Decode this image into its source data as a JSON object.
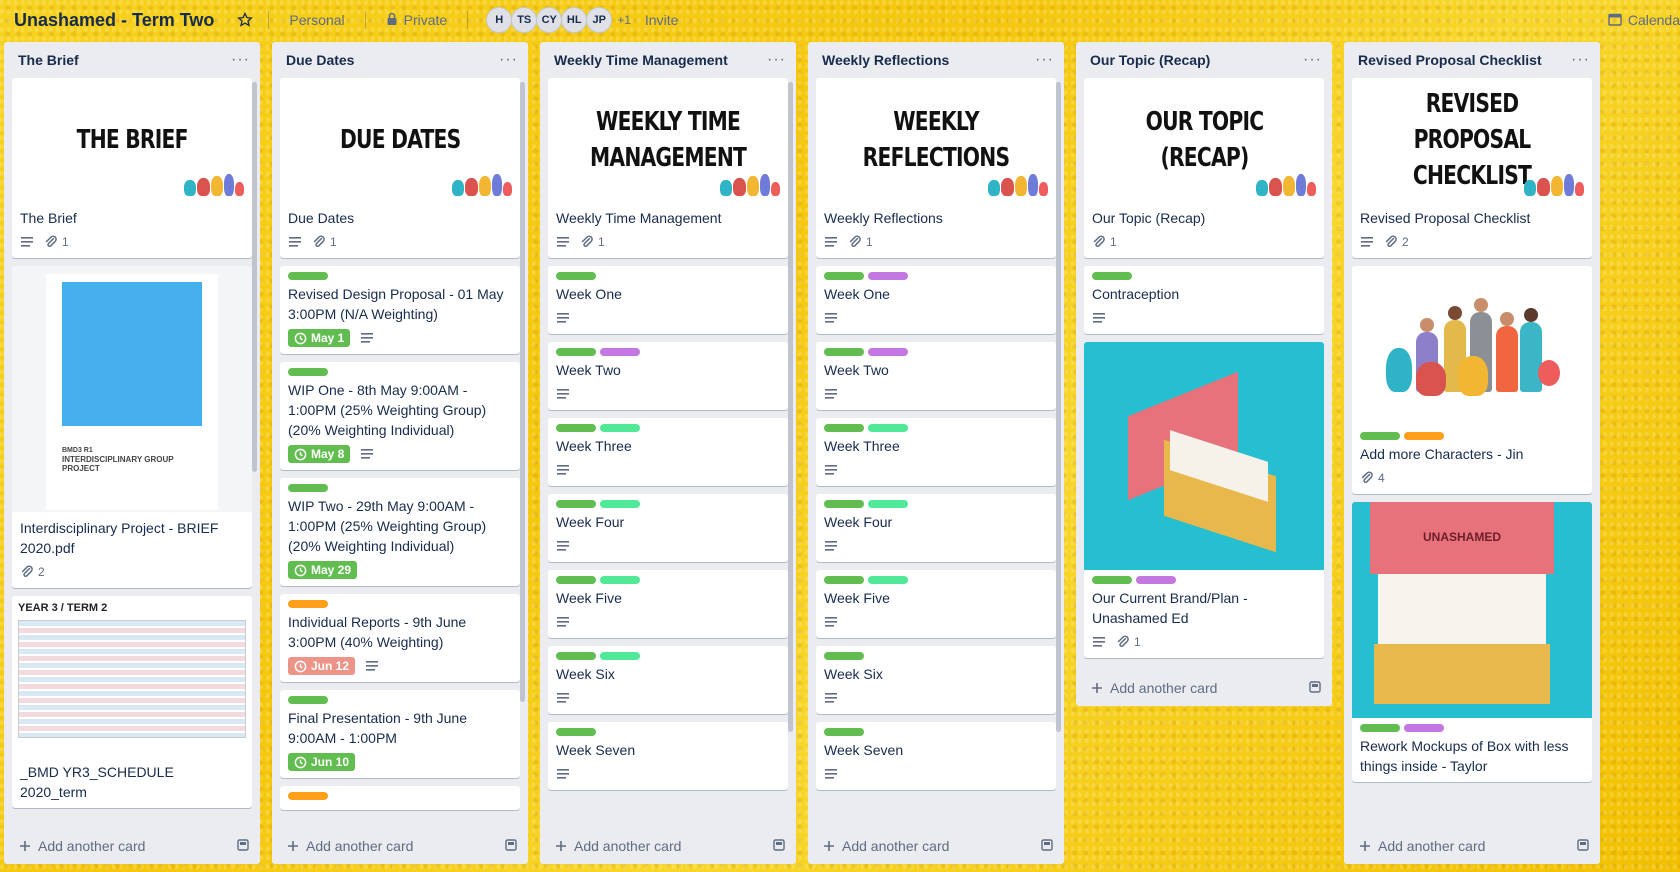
{
  "board": {
    "title": "Unashamed - Term Two",
    "visibility_personal": "Personal",
    "visibility_private": "Private",
    "members": [
      "H",
      "TS",
      "CY",
      "HL",
      "JP"
    ],
    "members_more": "+1",
    "invite": "Invite",
    "calendar": "Calenda"
  },
  "footer": {
    "add_card": "Add another card"
  },
  "colors": {
    "green": "#61bd4f",
    "purple": "#c377e0",
    "lime": "#51e898",
    "orange": "#ff9f1a",
    "red_due": "#ec9488"
  },
  "lists": {
    "brief": {
      "title": "The Brief",
      "cards": [
        {
          "cover_text": "THE BRIEF",
          "title": "The Brief",
          "attachments": "1"
        },
        {
          "title": "Interdisciplinary Project - BRIEF 2020.pdf",
          "attachments": "2",
          "pdf_code": "BMD3 R1",
          "pdf_heading": "INTERDISCIPLINARY GROUP PROJECT"
        },
        {
          "title": "_BMD YR3_SCHEDULE 2020_term",
          "sched_heading": "YEAR 3 / TERM 2"
        }
      ]
    },
    "due": {
      "title": "Due Dates",
      "cards": [
        {
          "cover_text": "DUE DATES",
          "title": "Due Dates",
          "attachments": "1"
        },
        {
          "title": "Revised Design Proposal - 01 May 3:00PM (N/A Weighting)",
          "due": "May 1"
        },
        {
          "title": "WIP One - 8th May 9:00AM - 1:00PM (25% Weighting Group) (20% Weighting Individual)",
          "due": "May 8"
        },
        {
          "title": "WIP Two - 29th May 9:00AM - 1:00PM (25% Weighting Group) (20% Weighting Individual)",
          "due": "May 29"
        },
        {
          "title": "Individual Reports - 9th June 3:00PM (40% Weighting)",
          "due": "Jun 12"
        },
        {
          "title": "Final Presentation - 9th June 9:00AM - 1:00PM",
          "due": "Jun 10"
        }
      ]
    },
    "time": {
      "title": "Weekly Time Management",
      "cover_line1": "WEEKLY TIME",
      "cover_line2": "MANAGEMENT",
      "cover_title": "Weekly Time Management",
      "attachments": "1",
      "weeks": [
        "Week One",
        "Week Two",
        "Week Three",
        "Week Four",
        "Week Five",
        "Week Six",
        "Week Seven"
      ]
    },
    "reflect": {
      "title": "Weekly Reflections",
      "cover_line1": "WEEKLY",
      "cover_line2": "REFLECTIONS",
      "cover_title": "Weekly Reflections",
      "attachments": "1",
      "weeks": [
        "Week One",
        "Week Two",
        "Week Three",
        "Week Four",
        "Week Five",
        "Week Six",
        "Week Seven"
      ]
    },
    "topic": {
      "title": "Our Topic (Recap)",
      "cover_line1": "OUR TOPIC",
      "cover_line2": "(RECAP)",
      "cover_title": "Our Topic (Recap)",
      "attachments": "1",
      "card2_title": "Contraception",
      "card3_title": "Our Current Brand/Plan - Unashamed Ed",
      "card3_attachments": "1"
    },
    "checklist": {
      "title": "Revised Proposal Checklist",
      "cover_line1": "REVISED PROPOSAL",
      "cover_line2": "CHECKLIST",
      "cover_title": "Revised Proposal Checklist",
      "attachments": "2",
      "card2_title": "Add more Characters - Jin",
      "card2_attachments": "4",
      "card3_title": "Rework Mockups of Box with less things inside - Taylor",
      "box_brand": "UNASHAMED"
    }
  }
}
